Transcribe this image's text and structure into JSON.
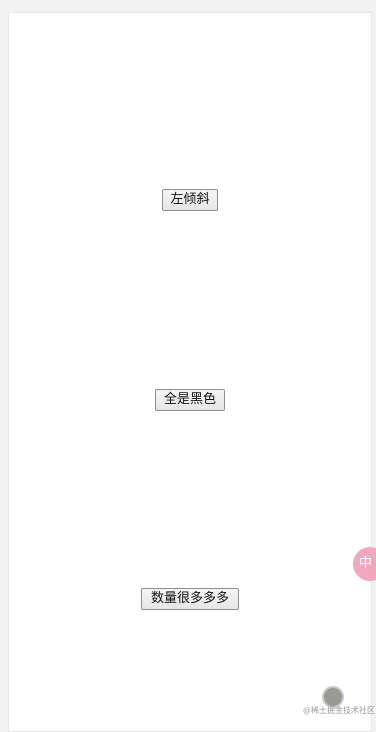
{
  "buttons": {
    "tilt_left": "左倾斜",
    "all_black": "全是黑色",
    "many_items": "数量很多多多"
  },
  "floating_badge": {
    "label": "中"
  },
  "watermark": {
    "text": "@稀土掘金技术社区"
  }
}
